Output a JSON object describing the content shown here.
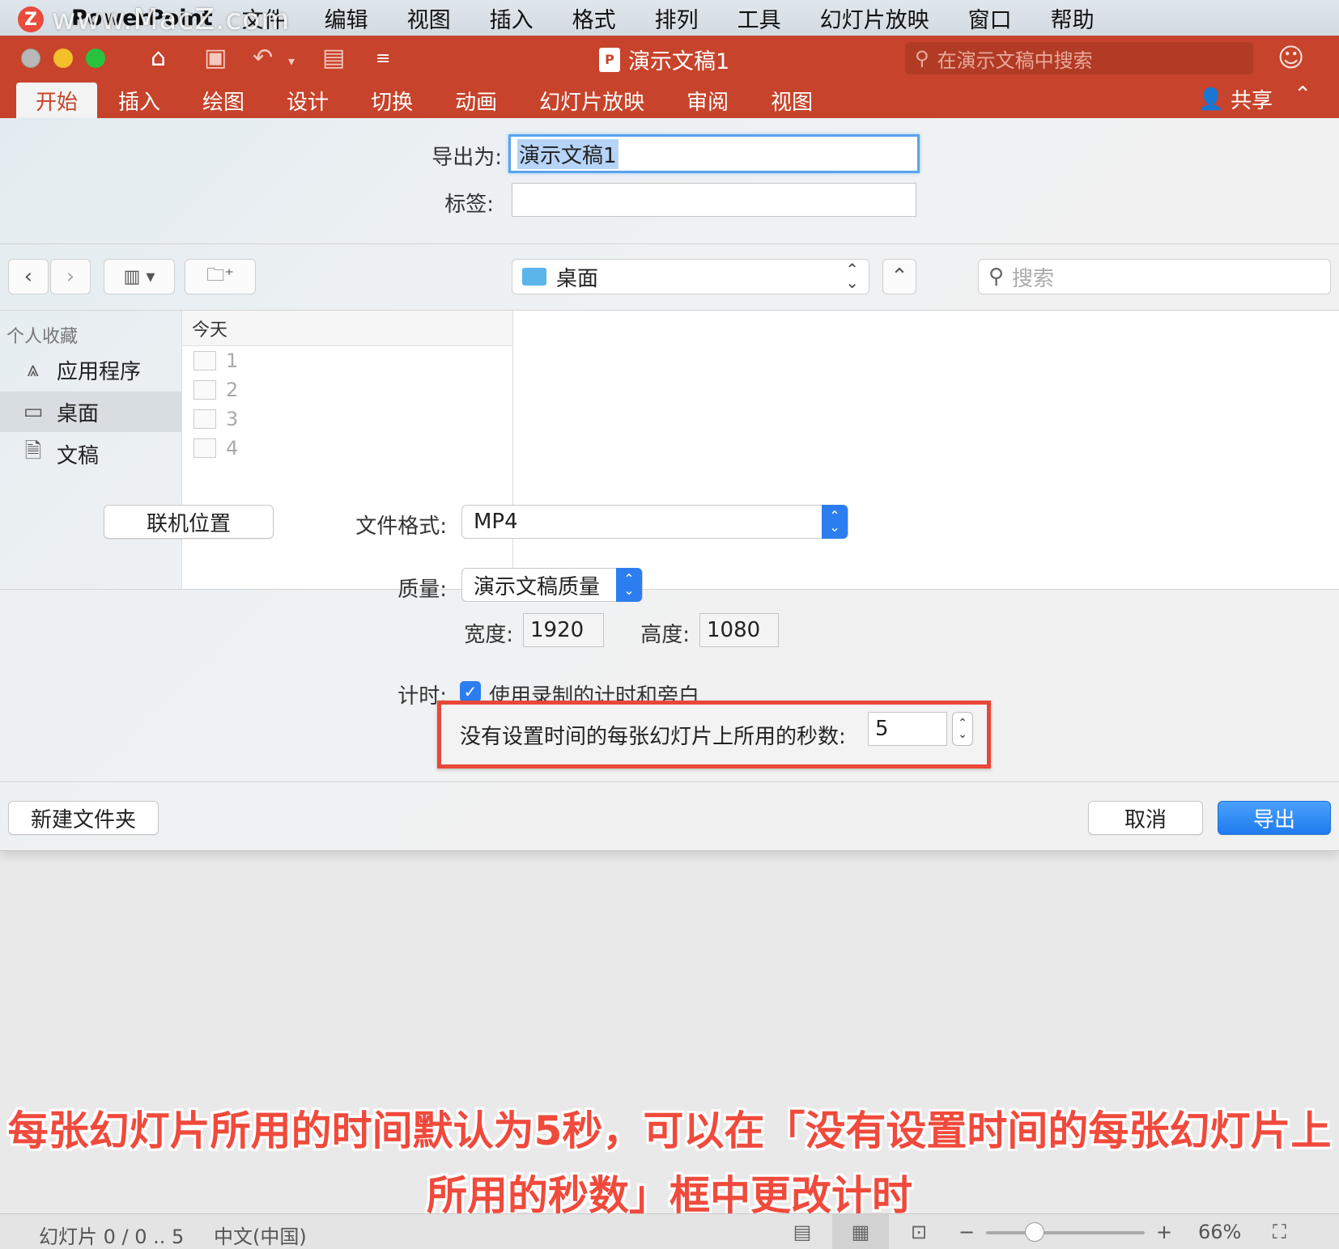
{
  "watermark": {
    "logo": "Z",
    "text": "www.MacZ.com"
  },
  "menubar": {
    "app_name": "PowerPoint",
    "items": [
      "文件",
      "编辑",
      "视图",
      "插入",
      "格式",
      "排列",
      "工具",
      "幻灯片放映",
      "窗口",
      "帮助"
    ]
  },
  "titlebar": {
    "doc_title": "演示文稿1",
    "doc_icon": "P",
    "search_placeholder": "在演示文稿中搜索"
  },
  "ribbon": {
    "tabs": [
      "开始",
      "插入",
      "绘图",
      "设计",
      "切换",
      "动画",
      "幻灯片放映",
      "审阅",
      "视图"
    ],
    "active_tab": "开始",
    "share_label": "共享"
  },
  "dialog": {
    "export_as_label": "导出为:",
    "export_as_value": "演示文稿1",
    "tags_label": "标签:",
    "tags_value": "",
    "location": "桌面",
    "search_placeholder": "搜索",
    "sidebar": {
      "header": "个人收藏",
      "items": [
        {
          "label": "应用程序",
          "icon": "apps-icon"
        },
        {
          "label": "桌面",
          "icon": "desktop-icon"
        },
        {
          "label": "文稿",
          "icon": "documents-icon"
        }
      ]
    },
    "file_column": {
      "header": "今天",
      "files": [
        "1",
        "2",
        "3",
        "4"
      ]
    },
    "online_locations_button": "联机位置",
    "file_format_label": "文件格式:",
    "file_format_value": "MP4",
    "quality_label": "质量:",
    "quality_value": "演示文稿质量",
    "width_label": "宽度:",
    "width_value": "1920",
    "height_label": "高度:",
    "height_value": "1080",
    "timing_label": "计时:",
    "timing_checkbox_label": "使用录制的计时和旁白",
    "timing_checked": true,
    "seconds_label": "没有设置时间的每张幻灯片上所用的秒数:",
    "seconds_value": "5",
    "new_folder_button": "新建文件夹",
    "cancel_button": "取消",
    "export_button": "导出"
  },
  "caption": {
    "line1": "每张幻灯片所用的时间默认为5秒，可以在「没有设置时间的每张幻灯片上",
    "line2": "所用的秒数」框中更改计时"
  },
  "statusbar": {
    "slide_info": "幻灯片 0 / 0 .. 5",
    "language": "中文(中国)",
    "zoom": "66%"
  },
  "colors": {
    "accent": "#c7432b",
    "primary_button": "#2c7ef0",
    "highlight_border": "#e8473a",
    "caption": "#f04a3c"
  }
}
